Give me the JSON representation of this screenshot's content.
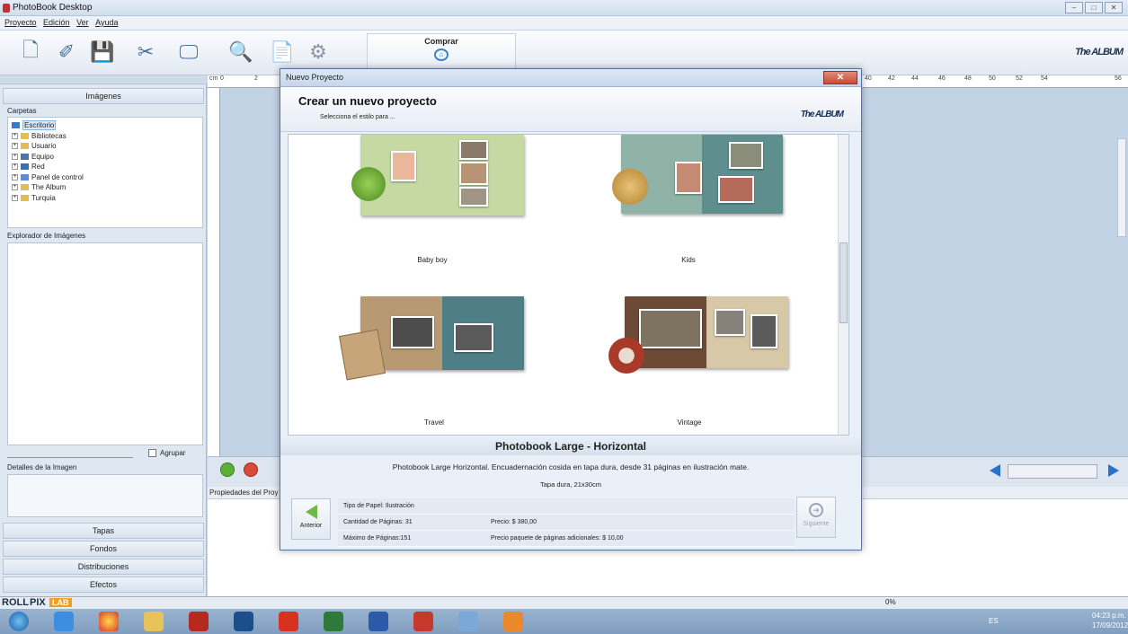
{
  "app": {
    "title": "PhotoBook Desktop"
  },
  "menu": [
    "Proyecto",
    "Edición",
    "Ver",
    "Ayuda"
  ],
  "toolbar": {
    "comprar_label": "Comprar",
    "brand": "The ALBUM"
  },
  "left": {
    "imagenes": "Imágenes",
    "carpetas": "Carpetas",
    "tree": [
      "Escritorio",
      "Bibliotecas",
      "Usuario",
      "Equipo",
      "Red",
      "Panel de control",
      "The Album",
      "Turquia"
    ],
    "explorador": "Explorador de Imágenes",
    "agrupar": "Agrupar",
    "detalles": "Detalles de la Imagen",
    "buttons": [
      "Tapas",
      "Fondos",
      "Distribuciones",
      "Efectos"
    ]
  },
  "workspace": {
    "ruler_unit": "cm",
    "ruler_left": [
      "0",
      "2"
    ],
    "ruler_right": [
      "40",
      "42",
      "44",
      "46",
      "48",
      "50",
      "52",
      "54",
      "56"
    ],
    "props_tab": "Propiedades del Proy",
    "zoom": "0%"
  },
  "footer": {
    "brand_roll": "ROLL",
    "brand_pix": "PIX",
    "brand_lab": "LAB"
  },
  "taskbar": {
    "lang": "ES",
    "time": "04:23 p.m.",
    "date": "17/09/2012"
  },
  "dialog": {
    "title": "Nuevo Proyecto",
    "heading": "Crear un nuevo proyecto",
    "subheading": "Selecciona el estilo para ...",
    "brand": "The ALBUM",
    "styles": [
      {
        "name": "Baby boy"
      },
      {
        "name": "Kids"
      },
      {
        "name": "Travel"
      },
      {
        "name": "Vintage"
      }
    ],
    "product_title": "Photobook Large - Horizontal",
    "product_desc": "Photobook Large Horizontal. Encuadernación cosida en tapa dura, desde 31 páginas en ilustración mate.",
    "product_size": "Tapa dura, 21x30cm",
    "paper": "Tipo de Papel: Ilustración",
    "pages": "Cantidad de Páginas: 31",
    "price": "Precio: $ 380,00",
    "max_pages": "Máximo de Páginas:151",
    "extra_price": "Precio paquete de páginas adicionales: $ 10,00",
    "prev": "Anterior",
    "next": "Siguiente"
  }
}
